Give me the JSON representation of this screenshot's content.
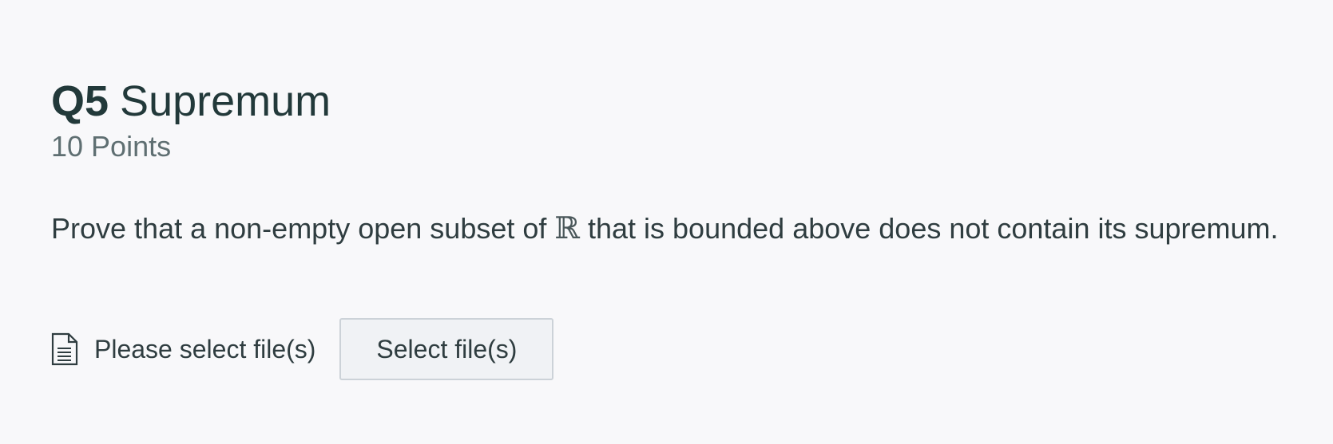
{
  "question": {
    "number": "Q5",
    "title": "Supremum",
    "points": "10 Points",
    "prompt_before": "Prove that a non-empty open subset of ",
    "prompt_symbol": "ℝ",
    "prompt_after": " that is bounded above does not contain its supremum."
  },
  "upload": {
    "status": "Please select file(s)",
    "button_label": "Select file(s)",
    "icon": "file-document-icon"
  },
  "colors": {
    "background": "#f8f8fa",
    "heading": "#22393a",
    "subtle_text": "#5f6f72",
    "button_background": "#f0f2f5",
    "button_border": "#ccd2d8"
  }
}
